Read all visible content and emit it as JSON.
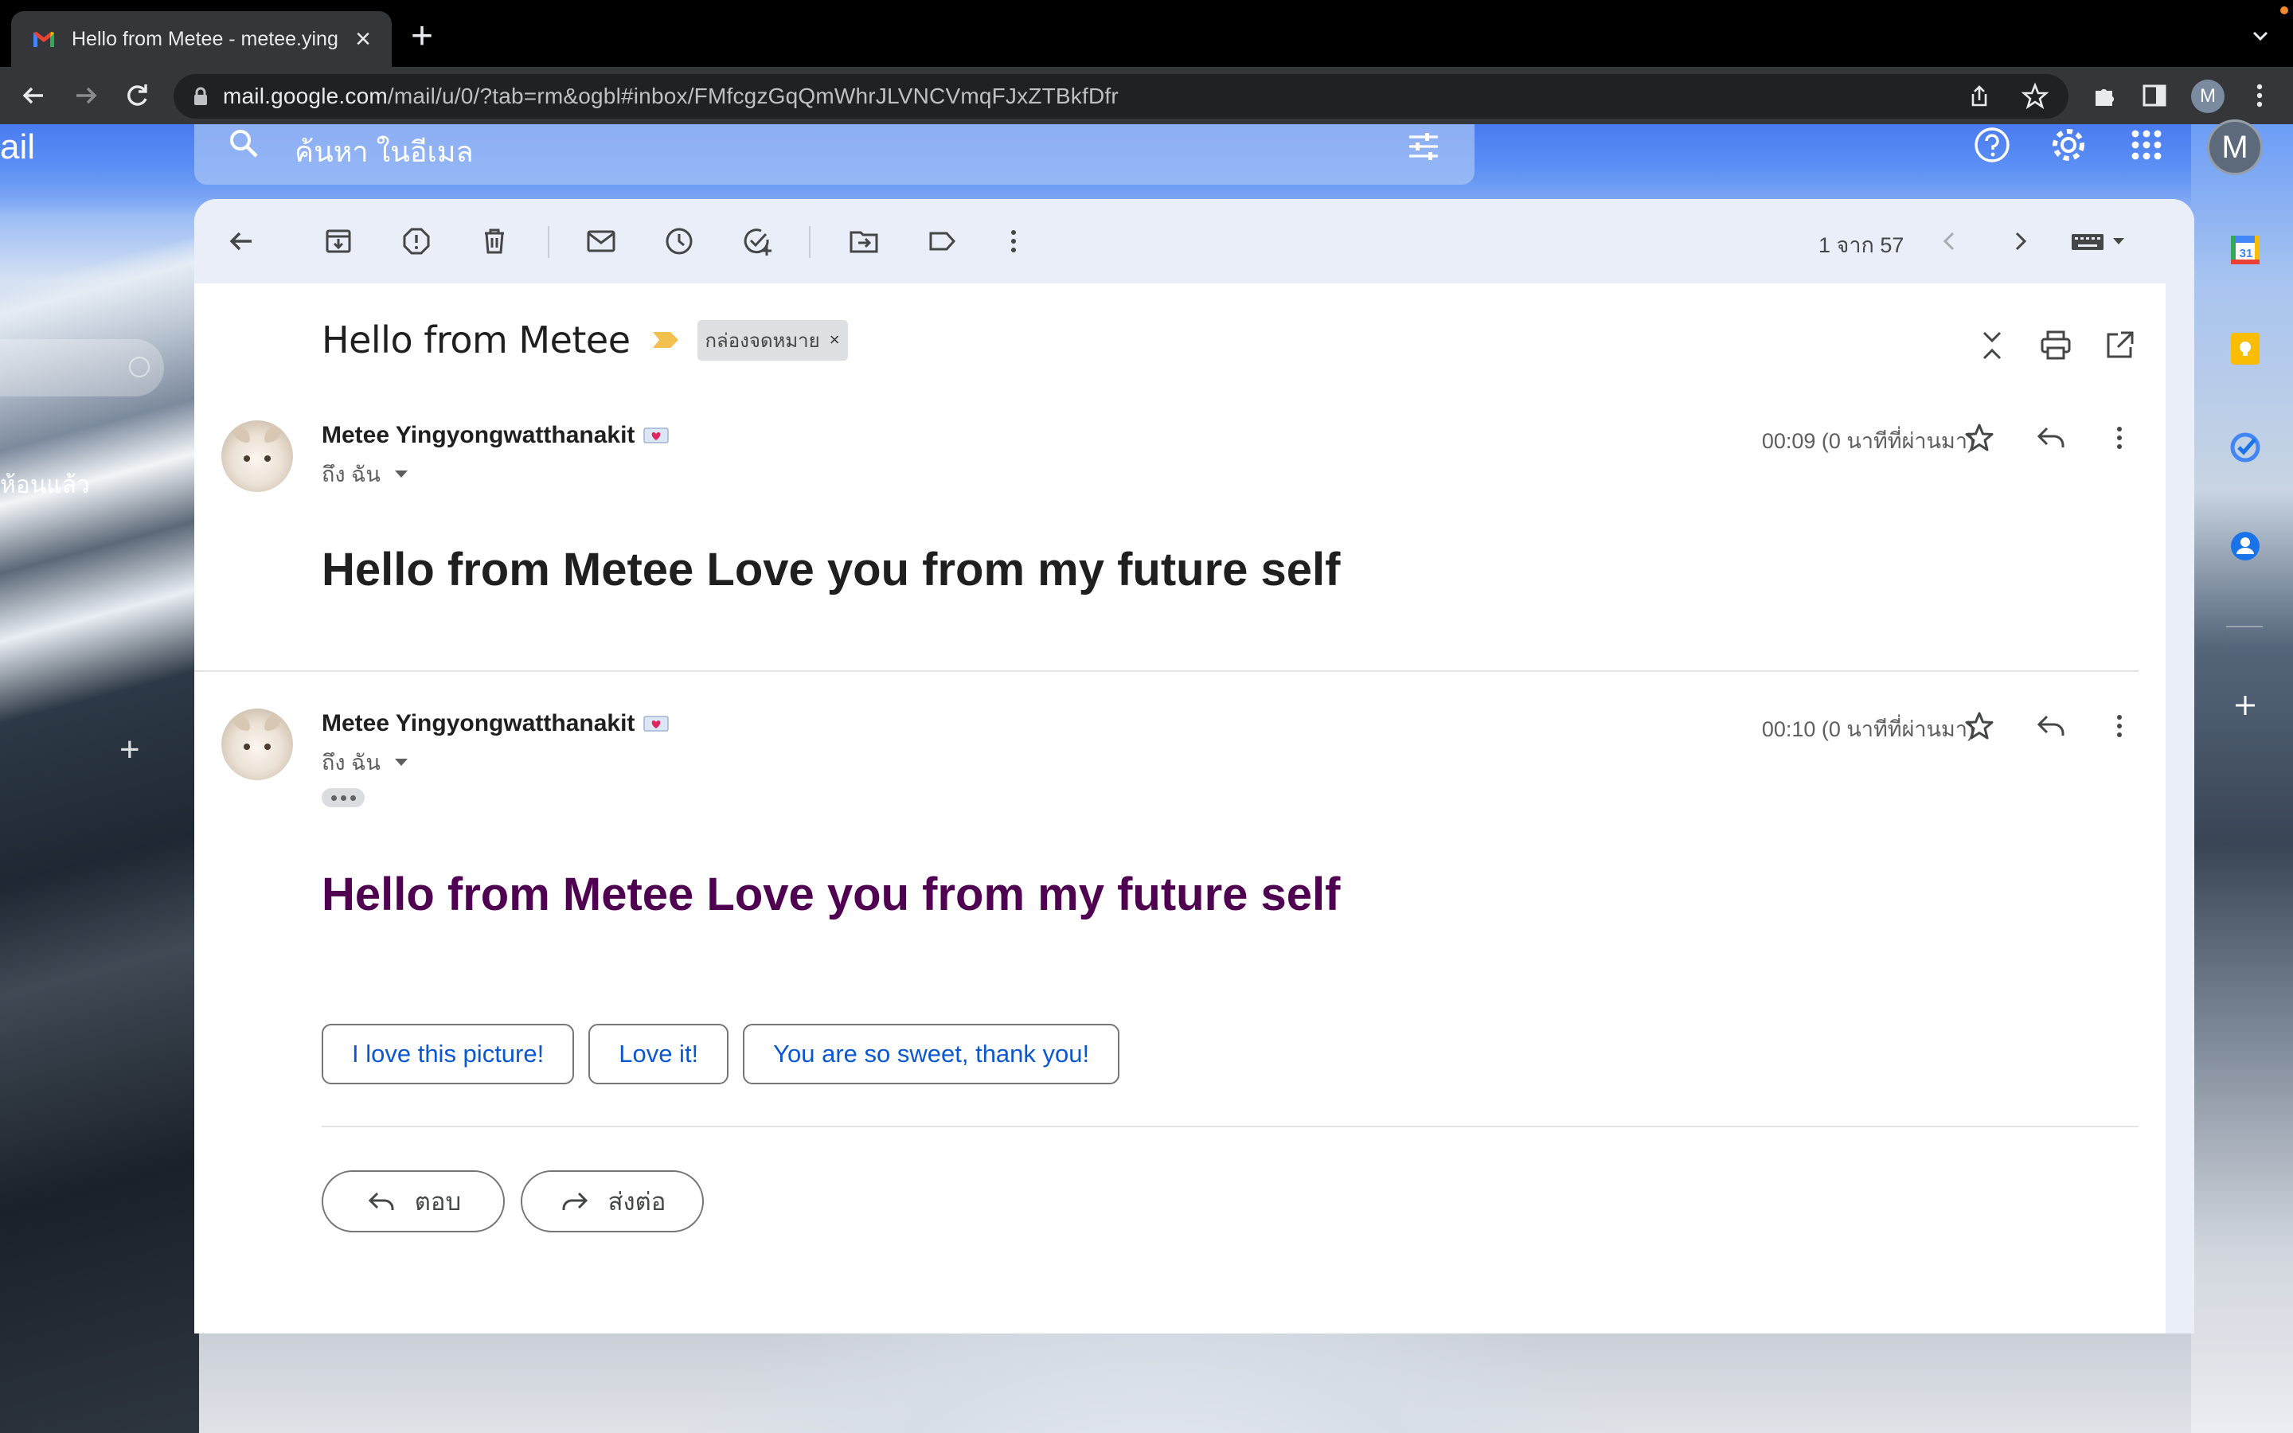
{
  "browser": {
    "tab_title": "Hello from Metee - metee.ying",
    "url_host": "mail.google.com",
    "url_path": "/mail/u/0/?tab=rm&ogbl#inbox/FMfcgzGqQmWhrJLVNCVmqFJxZTBkfDfr",
    "profile_initial": "M"
  },
  "gmail": {
    "logo_fragment": "ail",
    "sidebar_label_fragment": "ห้อนแล้ว",
    "search_placeholder": "ค้นหา ในอีเมล",
    "account_initial": "M",
    "pager": "1 จาก 57"
  },
  "thread": {
    "subject": "Hello from Metee",
    "label": "กล่องจดหมาย",
    "messages": [
      {
        "sender": "Metee Yingyongwatthanakit",
        "to": "ถึง ฉัน",
        "time": "00:09 (0 นาทีที่ผ่านมา)",
        "body": "Hello from Metee Love you from my future self",
        "body_color": "#1f1f1f"
      },
      {
        "sender": "Metee Yingyongwatthanakit",
        "to": "ถึง ฉัน",
        "time": "00:10 (0 นาทีที่ผ่านมา)",
        "body": "Hello from Metee Love you from my future self",
        "body_color": "#500050"
      }
    ],
    "smart_replies": [
      "I love this picture!",
      "Love it!",
      "You are so sweet, thank you!"
    ],
    "reply_label": "ตอบ",
    "forward_label": "ส่งต่อ"
  },
  "colors": {
    "accent_blue": "#0b57d0",
    "toolbar_bg": "#e9eef8",
    "quoted_purple": "#500050"
  },
  "icons": [
    "back-arrow-icon",
    "archive-icon",
    "report-spam-icon",
    "delete-icon",
    "mark-unread-icon",
    "snooze-icon",
    "add-task-icon",
    "move-to-icon",
    "label-icon",
    "more-vert-icon",
    "chevron-left-icon",
    "chevron-right-icon",
    "keyboard-icon",
    "collapse-all-icon",
    "print-icon",
    "open-new-window-icon",
    "star-icon",
    "reply-icon",
    "forward-icon",
    "help-icon",
    "settings-icon",
    "apps-icon",
    "calendar-icon",
    "keep-icon",
    "tasks-icon",
    "contacts-icon",
    "search-icon",
    "filter-icon"
  ]
}
